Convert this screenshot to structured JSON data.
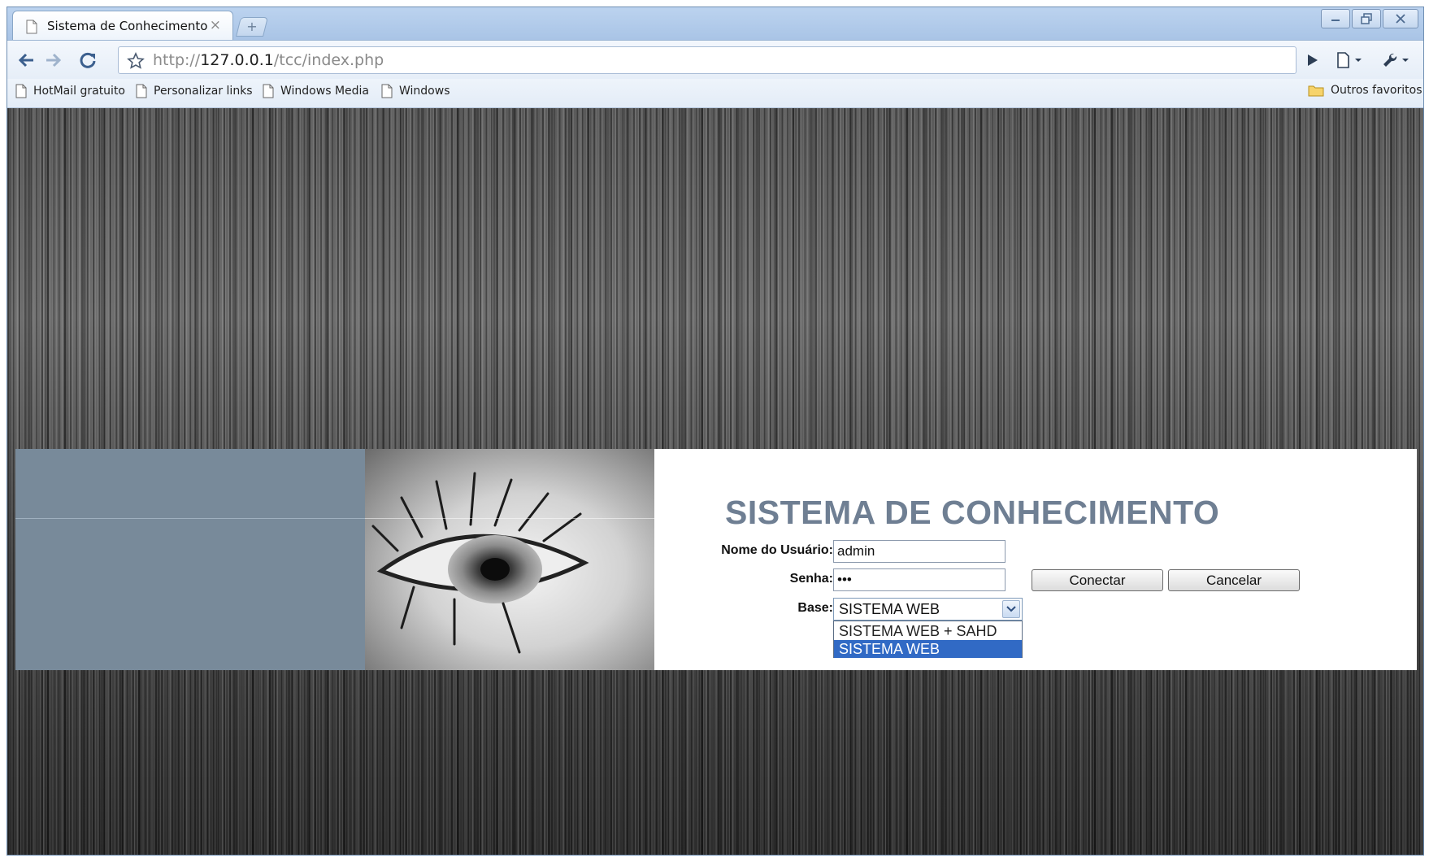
{
  "browser": {
    "tab_title": "Sistema de Conhecimento",
    "tab_close": "×",
    "new_tab": "+",
    "url_scheme": "http://",
    "url_host": "127.0.0.1",
    "url_path": "/tcc/index.php",
    "bookmarks": [
      "HotMail gratuito",
      "Personalizar links",
      "Windows Media",
      "Windows"
    ],
    "other_bookmarks": "Outros favoritos"
  },
  "page": {
    "title": "SISTEMA DE CONHECIMENTO",
    "username_label": "Nome do Usuário:",
    "username_value": "admin",
    "password_label": "Senha:",
    "password_value": "•••",
    "base_label": "Base:",
    "base_selected": "SISTEMA WEB",
    "base_options": [
      "SISTEMA WEB + SAHD",
      "SISTEMA WEB"
    ],
    "connect_button": "Conectar",
    "cancel_button": "Cancelar"
  },
  "colors": {
    "accent_title": "#6f7f93",
    "left_block": "#788a9a",
    "selected_option": "#316ac5"
  }
}
